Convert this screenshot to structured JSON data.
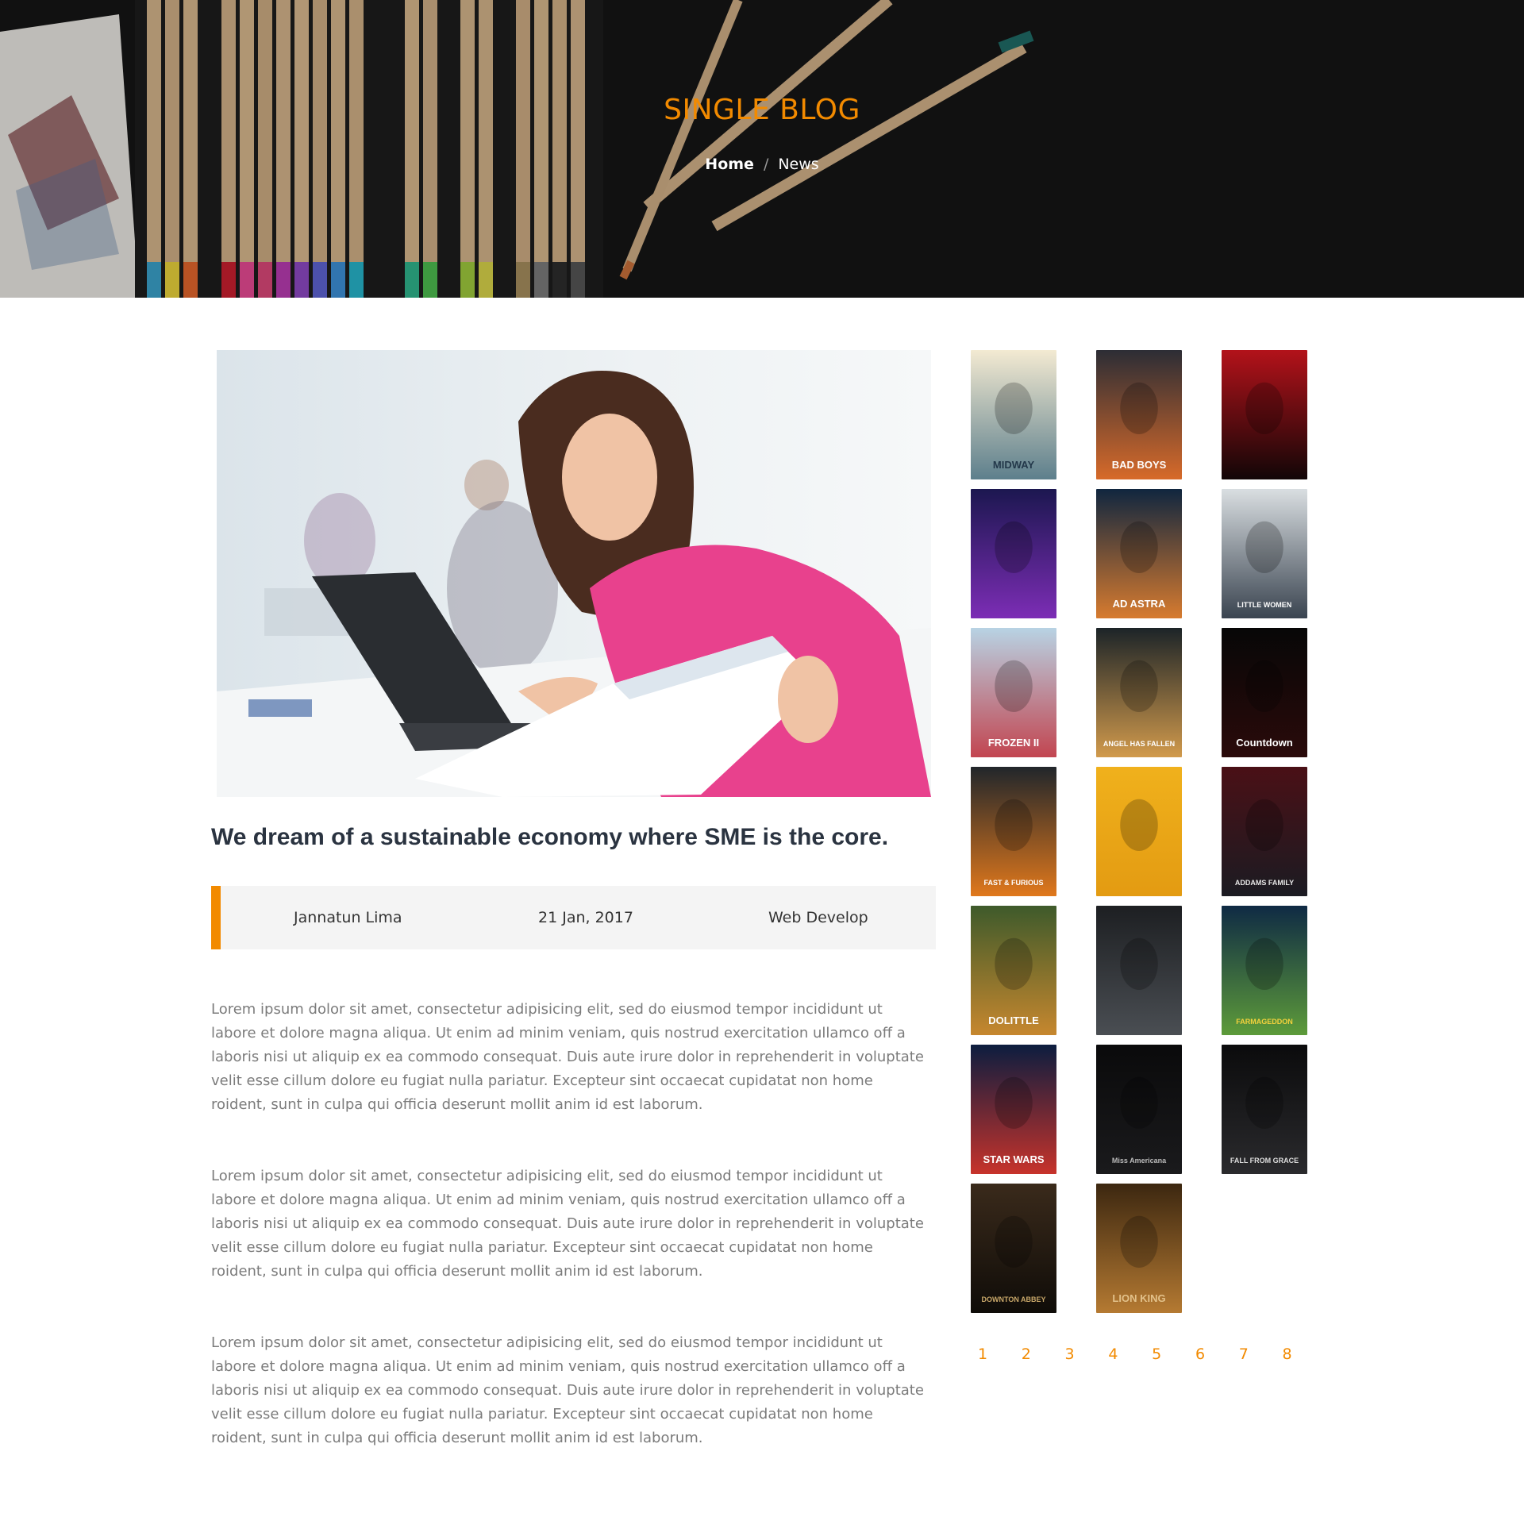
{
  "hero": {
    "title": "SINGLE BLOG",
    "breadcrumb": {
      "home": "Home",
      "separator": "/",
      "current": "News"
    }
  },
  "post": {
    "title": "We dream of a sustainable economy where SME is the core.",
    "meta": {
      "author": "Jannatun Lima",
      "date": "21 Jan, 2017",
      "category": "Web Develop"
    },
    "paragraphs": [
      "Lorem ipsum dolor sit amet, consectetur adipisicing elit, sed do eiusmod tempor incididunt ut labore et dolore magna aliqua. Ut enim ad minim veniam, quis nostrud exercitation ullamco off a laboris nisi ut aliquip ex ea commodo consequat. Duis aute irure dolor in reprehenderit in voluptate velit esse cillum dolore eu fugiat nulla pariatur. Excepteur sint occaecat cupidatat non home roident, sunt in culpa qui officia deserunt mollit anim id est laborum.",
      "Lorem ipsum dolor sit amet, consectetur adipisicing elit, sed do eiusmod tempor incididunt ut labore et dolore magna aliqua. Ut enim ad minim veniam, quis nostrud exercitation ullamco off a laboris nisi ut aliquip ex ea commodo consequat. Duis aute irure dolor in reprehenderit in voluptate velit esse cillum dolore eu fugiat nulla pariatur. Excepteur sint occaecat cupidatat non home roident, sunt in culpa qui officia deserunt mollit anim id est laborum.",
      "Lorem ipsum dolor sit amet, consectetur adipisicing elit, sed do eiusmod tempor incididunt ut labore et dolore magna aliqua. Ut enim ad minim veniam, quis nostrud exercitation ullamco off a laboris nisi ut aliquip ex ea commodo consequat. Duis aute irure dolor in reprehenderit in voluptate velit esse cillum dolore eu fugiat nulla pariatur. Excepteur sint occaecat cupidatat non home roident, sunt in culpa qui officia deserunt mollit anim id est laborum."
    ]
  },
  "posters": [
    {
      "name": "poster-midway",
      "caption": "MIDWAY",
      "bg": "#f3ead2",
      "bg2": "#5d7f8c",
      "fg": "#23384a"
    },
    {
      "name": "poster-bad-boys",
      "caption": "BAD BOYS",
      "bg": "#2c2d35",
      "bg2": "#d76a2a",
      "fg": "#ffffff"
    },
    {
      "name": "poster-it",
      "caption": "",
      "bg": "#b3121a",
      "bg2": "#120607",
      "fg": "#ffffff"
    },
    {
      "name": "poster-avengers",
      "caption": "",
      "bg": "#1c1750",
      "bg2": "#7c2db5",
      "fg": "#ffffff"
    },
    {
      "name": "poster-ad-astra",
      "caption": "AD ASTRA",
      "bg": "#10263f",
      "bg2": "#d77b2f",
      "fg": "#ffffff"
    },
    {
      "name": "poster-little-women",
      "caption": "LITTLE WOMEN",
      "bg": "#d9dee1",
      "bg2": "#3a4450",
      "fg": "#ffffff"
    },
    {
      "name": "poster-frozen-ii",
      "caption": "FROZEN II",
      "bg": "#b8d3e4",
      "bg2": "#c24550",
      "fg": "#ffffff"
    },
    {
      "name": "poster-angel-has-fallen",
      "caption": "ANGEL HAS FALLEN",
      "bg": "#1c2428",
      "bg2": "#d19a4c",
      "fg": "#ffffff"
    },
    {
      "name": "poster-countdown",
      "caption": "Countdown",
      "bg": "#070707",
      "bg2": "#2a0a0a",
      "fg": "#ffffff"
    },
    {
      "name": "poster-fast-furious",
      "caption": "FAST & FURIOUS",
      "bg": "#21262b",
      "bg2": "#e0781c",
      "fg": "#ffffff"
    },
    {
      "name": "poster-beautiful-day",
      "caption": "",
      "bg": "#f0b11c",
      "bg2": "#e39b12",
      "fg": "#8c2a1c"
    },
    {
      "name": "poster-addams-family",
      "caption": "ADDAMS FAMILY",
      "bg": "#4a1016",
      "bg2": "#1b1b22",
      "fg": "#e6e6e6"
    },
    {
      "name": "poster-dolittle",
      "caption": "DOLITTLE",
      "bg": "#3e5a2b",
      "bg2": "#c6872e",
      "fg": "#ffffff"
    },
    {
      "name": "poster-irishman",
      "caption": "",
      "bg": "#1d1f22",
      "bg2": "#4a4e53",
      "fg": "#c21a1a"
    },
    {
      "name": "poster-farmageddon",
      "caption": "FARMAGEDDON",
      "bg": "#0f2a44",
      "bg2": "#5d9b3a",
      "fg": "#f4d23c"
    },
    {
      "name": "poster-star-wars",
      "caption": "STAR WARS",
      "bg": "#0c1d3f",
      "bg2": "#c7332b",
      "fg": "#ffffff"
    },
    {
      "name": "poster-miss-americana",
      "caption": "Miss Americana",
      "bg": "#0a0a0b",
      "bg2": "#1a1a1c",
      "fg": "#bbbbbb"
    },
    {
      "name": "poster-fall-from-grace",
      "caption": "FALL FROM GRACE",
      "bg": "#0b0b0c",
      "bg2": "#2a2a2d",
      "fg": "#dddddd"
    },
    {
      "name": "poster-downton-abbey",
      "caption": "DOWNTON ABBEY",
      "bg": "#3a2a1b",
      "bg2": "#0f0c08",
      "fg": "#c9a86a"
    },
    {
      "name": "poster-lion-king",
      "caption": "LION KING",
      "bg": "#3c2710",
      "bg2": "#b57a32",
      "fg": "#e2c18a"
    }
  ],
  "pagination": [
    "1",
    "2",
    "3",
    "4",
    "5",
    "6",
    "7",
    "8"
  ],
  "colors": {
    "accent": "#f28a00",
    "heading": "#2a3340",
    "body_text": "#7b7b7b",
    "meta_bg": "#f4f4f4"
  }
}
